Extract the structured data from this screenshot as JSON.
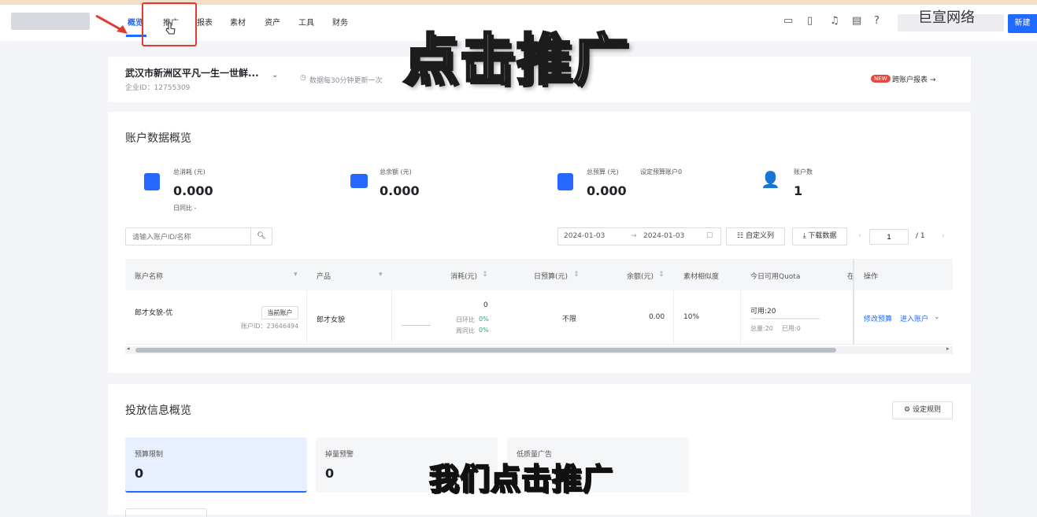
{
  "nav": {
    "items": [
      "概览",
      "推广",
      "报表",
      "素材",
      "资产",
      "工具",
      "财务"
    ],
    "active": "概览"
  },
  "header_right": {
    "brand": "巨宣网络",
    "new_button": "新建",
    "icons": [
      "tablet-icon",
      "mobile-icon",
      "bell-icon",
      "message-icon",
      "help-icon"
    ]
  },
  "account": {
    "name": "武汉市新洲区平凡一生一世鲜...",
    "enterprise_id": "企业ID：12755309",
    "update_note": "数据每30分钟更新一次",
    "cross_report_badge": "NEW",
    "cross_report": "跨账户报表 →"
  },
  "overlay": {
    "headline": "点击推广",
    "subtitle": "我们点击推广"
  },
  "overview": {
    "title": "账户数据概览",
    "stats": [
      {
        "label": "总消耗 (元)",
        "value": "0.000",
        "sub": "日同比 -"
      },
      {
        "label": "总余额 (元)",
        "value": "0.000",
        "sub": ""
      },
      {
        "label": "总预算 (元)",
        "extra": "设定预算账户0",
        "value": "0.000",
        "sub": ""
      },
      {
        "label": "账户数",
        "value": "1",
        "sub": ""
      }
    ],
    "search_placeholder": "请输入账户ID/名称",
    "date_start": "2024-01-03",
    "date_end": "2024-01-03",
    "custom_columns": "自定义列",
    "download": "下载数据",
    "page_current": "1",
    "page_total": "/ 1"
  },
  "table": {
    "headers": [
      "账户名称",
      "产品",
      "消耗(元)",
      "日预算(元)",
      "余额(元)",
      "素材相似度",
      "今日可用Quota",
      "在",
      "操作"
    ],
    "row": {
      "account_name": "郎才女貌-优",
      "current_tag": "当前账户",
      "account_id": "账户ID：23646494",
      "product": "郎才女貌",
      "spend": "0",
      "day_ratio_label": "日环比",
      "day_ratio": "0%",
      "week_ratio_label": "周同比",
      "week_ratio": "0%",
      "budget": "不限",
      "balance": "0.00",
      "similarity": "10%",
      "quota_available": "可用:20",
      "quota_total": "总量:20",
      "quota_used": "已用:0",
      "action_budget": "修改预算",
      "action_enter": "进入账户"
    }
  },
  "delivery": {
    "title": "投放信息概览",
    "rule_button": "设定规则",
    "cards": [
      {
        "label": "预算限制",
        "value": "0"
      },
      {
        "label": "掉量预警",
        "value": "0"
      },
      {
        "label": "低质量广告",
        "value": ""
      }
    ]
  },
  "colors": {
    "accent": "#1f6bff",
    "highlight": "#e03b31",
    "positive": "#2ba471"
  }
}
